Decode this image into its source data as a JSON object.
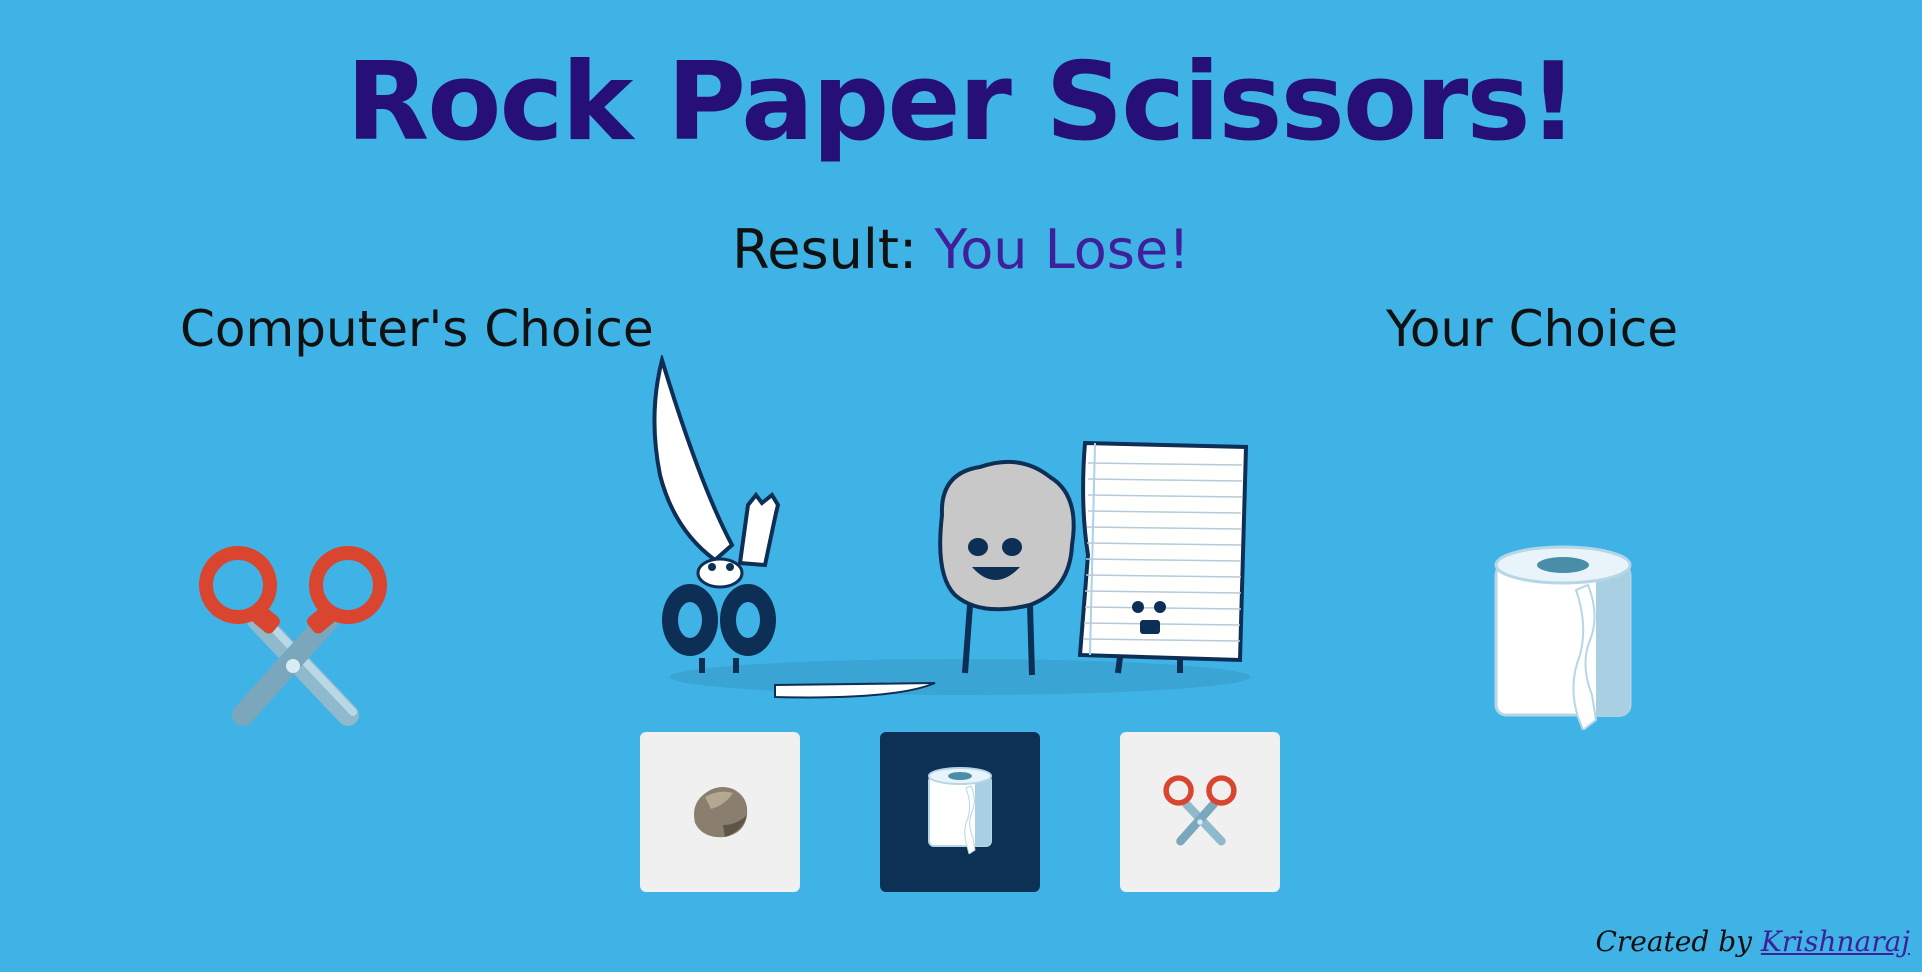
{
  "title": "Rock Paper Scissors!",
  "result": {
    "label": "Result:",
    "outcome": "You Lose!"
  },
  "computer": {
    "label": "Computer's Choice",
    "pick_icon": "scissors-icon"
  },
  "player": {
    "label": "Your Choice",
    "pick_icon": "paper-roll-icon"
  },
  "options": [
    {
      "name": "rock",
      "icon": "rock-icon",
      "selected": false
    },
    {
      "name": "paper",
      "icon": "paper-roll-icon",
      "selected": true
    },
    {
      "name": "scissors",
      "icon": "scissors-icon",
      "selected": false
    }
  ],
  "footer": {
    "prefix": "Created by",
    "author": "Krishnaraj"
  },
  "colors": {
    "background": "#3fb3e6",
    "title": "#261077",
    "outcome": "#3f1f9a",
    "selected_option": "#0d3055",
    "option": "#f0f0f0"
  }
}
